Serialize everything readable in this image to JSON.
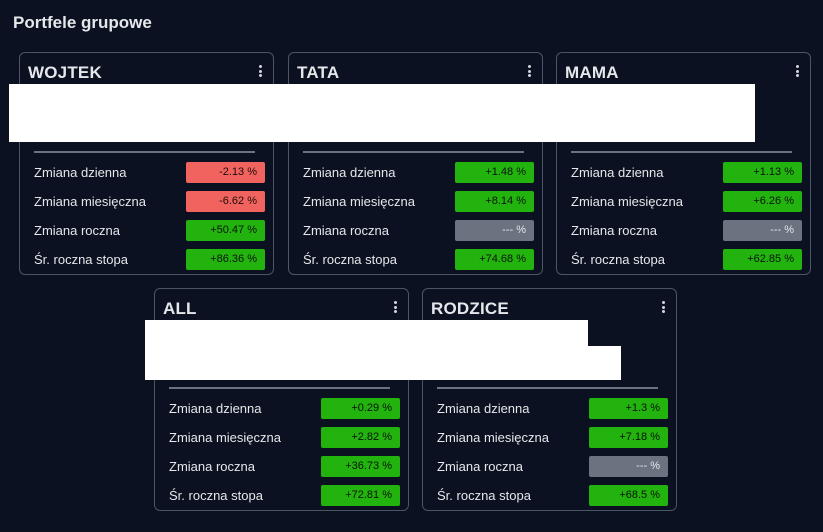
{
  "header": {
    "title": "Portfele grupowe"
  },
  "labels": {
    "daily": "Zmiana dzienna",
    "monthly": "Zmiana miesięczna",
    "yearly": "Zmiana roczna",
    "avg_rate": "Śr. roczna stopa"
  },
  "cards": [
    {
      "name": "WOJTEK",
      "daily": "-2.13 %",
      "monthly": "-6.62 %",
      "yearly": "+50.47 %",
      "avg_rate": "+86.36 %"
    },
    {
      "name": "TATA",
      "daily": "+1.48 %",
      "monthly": "+8.14 %",
      "yearly": "--- %",
      "avg_rate": "+74.68 %"
    },
    {
      "name": "MAMA",
      "daily": "+1.13 %",
      "monthly": "+6.26 %",
      "yearly": "--- %",
      "avg_rate": "+62.85 %"
    },
    {
      "name": "ALL",
      "daily": "+0.29 %",
      "monthly": "+2.82 %",
      "yearly": "+36.73 %",
      "avg_rate": "+72.81 %"
    },
    {
      "name": "RODZICE",
      "daily": "+1.3 %",
      "monthly": "+7.18 %",
      "yearly": "--- %",
      "avg_rate": "+68.5 %"
    }
  ],
  "colors": {
    "positive": "#22b30e",
    "negative": "#f0635e",
    "neutral": "#6b7280",
    "background": "#0b1120"
  },
  "icons": {
    "card_menu": "vertical-ellipsis-icon"
  }
}
